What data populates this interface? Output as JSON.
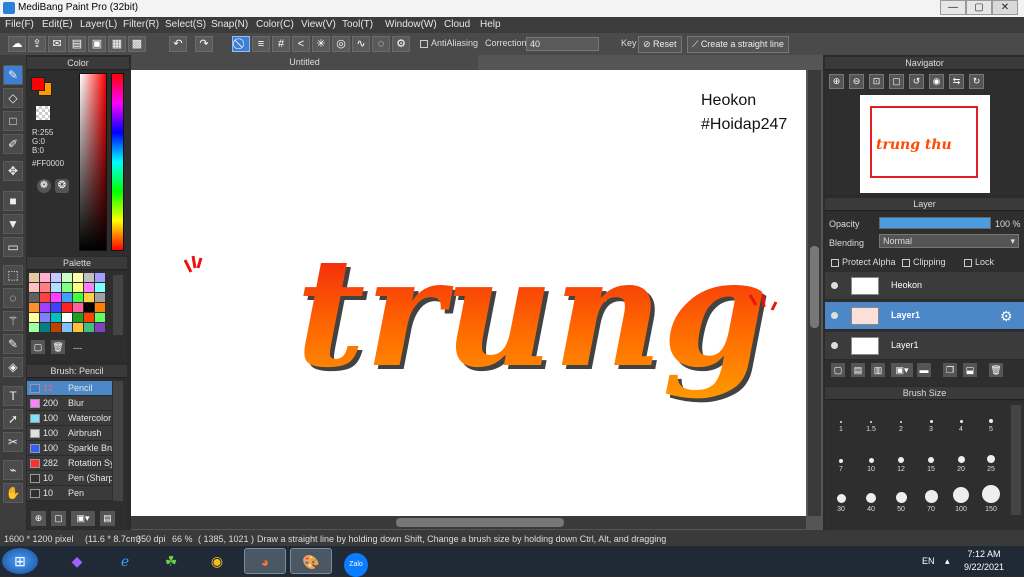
{
  "window": {
    "title": "MediBang Paint Pro (32bit)",
    "min": "—",
    "restore": "▢",
    "close": "✕"
  },
  "menu": [
    "File(F)",
    "Edit(E)",
    "Layer(L)",
    "Filter(R)",
    "Select(S)",
    "Snap(N)",
    "Color(C)",
    "View(V)",
    "Tool(T)",
    "Window(W)",
    "Cloud",
    "Help"
  ],
  "toolbar": {
    "antialiasing": "AntiAliasing",
    "correction_label": "Correction",
    "correction_value": "40",
    "key": "Key",
    "reset": "Reset",
    "straight_line": "Create a straight line"
  },
  "document": {
    "tab_title": "Untitled",
    "watermark_line1": "Heokon",
    "watermark_line2": "#Hoidap247",
    "artwork_text": "trung thu"
  },
  "color_panel": {
    "title": "Color",
    "r": "R:255",
    "g": "G:0",
    "b": "B:0",
    "hex": "#FF0000",
    "primary": "#ff0000",
    "secondary": "#ff9900"
  },
  "palette_panel": {
    "title": "Palette",
    "footer": "---",
    "swatches": [
      "#e6c8a0",
      "#ffb0d0",
      "#c8c8ff",
      "#c8ffc8",
      "#ffffb0",
      "#c0c0c0",
      "#a0a0ff",
      "#ffc0c0",
      "#ff8080",
      "#b0e0ff",
      "#80ff80",
      "#ffff80",
      "#ff80ff",
      "#80ffff",
      "#606060",
      "#ff4040",
      "#ff40ff",
      "#40a0ff",
      "#40ff40",
      "#ffd040",
      "#a0a0a0",
      "#ff9030",
      "#a040ff",
      "#4040ff",
      "#ff2020",
      "#ff60a0",
      "#000000",
      "#ff8000",
      "#ffffa0",
      "#8080ff",
      "#00c0c0",
      "#ffffff",
      "#20a020",
      "#ff4000",
      "#60ff60",
      "#a0ffa0",
      "#008080",
      "#c04000",
      "#80c0ff",
      "#ffc040",
      "#40c080",
      "#8040c0"
    ]
  },
  "brush_panel": {
    "title": "Brush: Pencil",
    "items": [
      {
        "size": "12",
        "name": "Pencil",
        "color": "#3e78c8"
      },
      {
        "size": "200",
        "name": "Blur",
        "color": "#ff80ff"
      },
      {
        "size": "100",
        "name": "Watercolor",
        "color": "#80e0ff"
      },
      {
        "size": "100",
        "name": "Airbrush",
        "color": "#e0e0e0"
      },
      {
        "size": "100",
        "name": "Sparkle Brush",
        "color": "#3060ff"
      },
      {
        "size": "282",
        "name": "Rotation Sym",
        "color": "#ff3030"
      },
      {
        "size": "10",
        "name": "Pen (Sharp)",
        "color": "#303030"
      },
      {
        "size": "10",
        "name": "Pen",
        "color": "#303030"
      }
    ]
  },
  "navigator": {
    "title": "Navigator"
  },
  "layer_panel": {
    "title": "Layer",
    "opacity_label": "Opacity",
    "opacity_value": "100 %",
    "opacity_level": 1.0,
    "blending_label": "Blending",
    "blending_value": "Normal",
    "protect_alpha": "Protect Alpha",
    "clipping": "Clipping",
    "lock": "Lock",
    "layers": [
      {
        "name": "Heokon"
      },
      {
        "name": "Layer1"
      },
      {
        "name": "Layer1"
      }
    ]
  },
  "brush_size_panel": {
    "title": "Brush Size",
    "sizes": [
      "1",
      "1.5",
      "2",
      "3",
      "4",
      "5",
      "7",
      "10",
      "12",
      "15",
      "20",
      "25",
      "30",
      "40",
      "50",
      "70",
      "100",
      "150"
    ]
  },
  "status": {
    "pixels": "1600 * 1200 pixel",
    "cm": "(11.6 * 8.7cm)",
    "dpi": "350 dpi",
    "zoom": "66 %",
    "coords": "( 1385, 1021 )",
    "hint": "Draw a straight line by holding down Shift, Change a brush size by holding down Ctrl, Alt, and dragging"
  },
  "taskbar": {
    "lang": "EN",
    "time": "7:12 AM",
    "date": "9/22/2021",
    "zalo": "Zalo"
  }
}
